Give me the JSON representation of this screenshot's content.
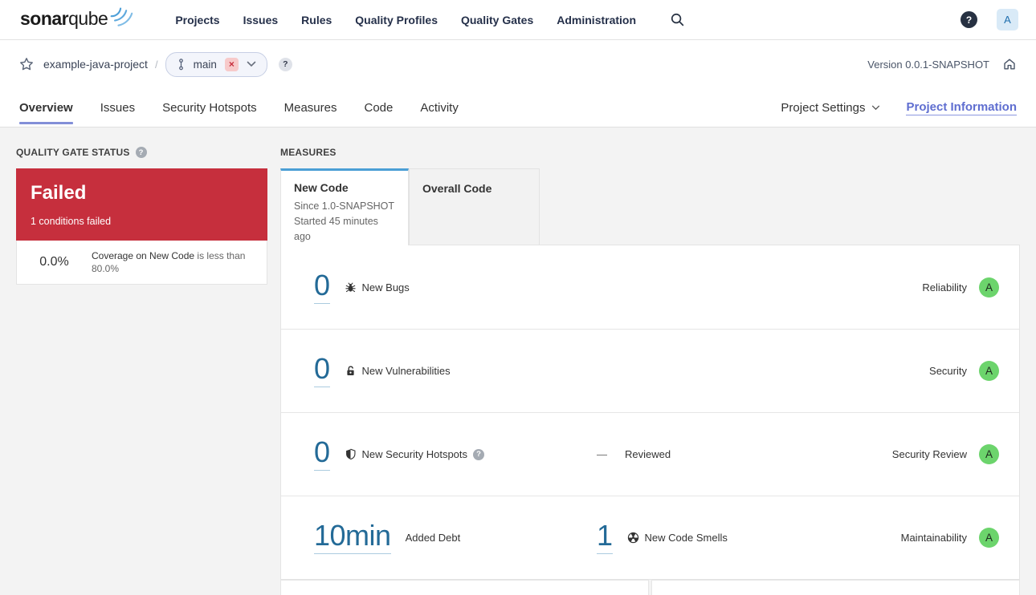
{
  "colors": {
    "status_failed_red": "#c62f3d",
    "rating_a_green": "#6cd46c",
    "metric_link_blue": "#236a97",
    "accent_indigo": "#828fd8",
    "new_code_tab_blue": "#4b9fd5"
  },
  "nav": {
    "logo_bold": "sonar",
    "logo_light": "qube",
    "items": [
      "Projects",
      "Issues",
      "Rules",
      "Quality Profiles",
      "Quality Gates",
      "Administration"
    ],
    "help": "?",
    "avatar_initial": "A"
  },
  "breadcrumb": {
    "project": "example-java-project",
    "separator": "/",
    "branch_name": "main",
    "branch_close": "×",
    "branch_help": "?",
    "version": "Version 0.0.1-SNAPSHOT"
  },
  "tabs": {
    "items": [
      "Overview",
      "Issues",
      "Security Hotspots",
      "Measures",
      "Code",
      "Activity"
    ],
    "active": "Overview",
    "project_settings": "Project Settings",
    "project_information": "Project Information"
  },
  "quality_gate": {
    "section_title": "QUALITY GATE STATUS",
    "help": "?",
    "status": "Failed",
    "summary": "1 conditions failed",
    "condition_value": "0.0%",
    "condition_metric": "Coverage on New Code",
    "condition_rest": " is less than 80.0%"
  },
  "measures": {
    "section_title": "MEASURES",
    "new_code_tab": {
      "label": "New Code",
      "since": "Since 1.0-SNAPSHOT",
      "started": "Started 45 minutes ago"
    },
    "overall_code_tab": {
      "label": "Overall Code"
    },
    "rows": [
      {
        "value": "0",
        "label": "New Bugs",
        "category": "Reliability",
        "rating": "A"
      },
      {
        "value": "0",
        "label": "New Vulnerabilities",
        "category": "Security",
        "rating": "A"
      },
      {
        "value": "0",
        "label": "New Security Hotspots",
        "help": "?",
        "dash": "—",
        "secondary_label": "Reviewed",
        "category": "Security Review",
        "rating": "A"
      },
      {
        "value": "10min",
        "label": "Added Debt",
        "secondary_value": "1",
        "secondary_label": "New Code Smells",
        "category": "Maintainability",
        "rating": "A"
      }
    ]
  }
}
